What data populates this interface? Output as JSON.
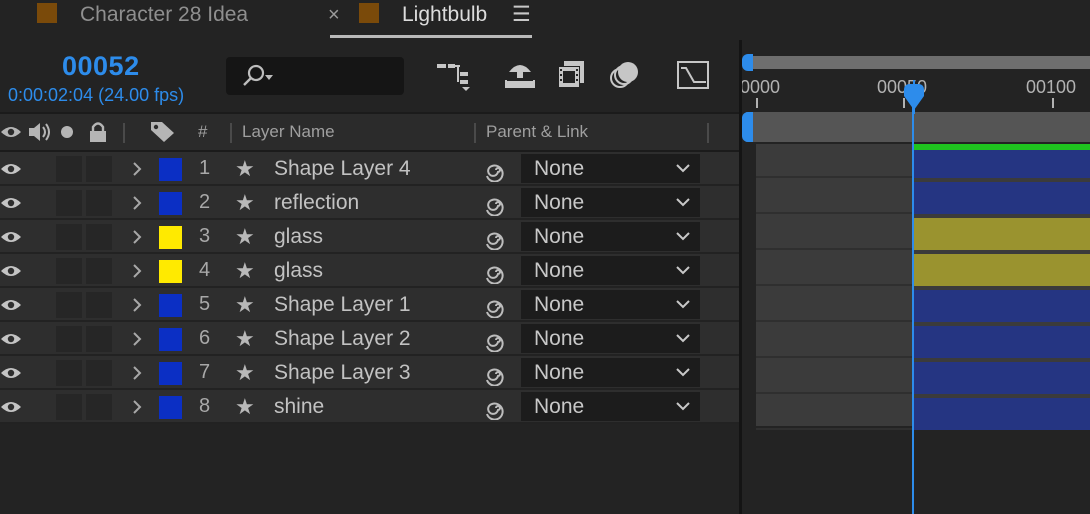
{
  "tabs": [
    {
      "label": "Character 28 Idea",
      "close_glyph": "×",
      "active": false,
      "swatch_color": "#7a4a0a"
    },
    {
      "label": "Lightbulb",
      "menu_glyph": "☰",
      "active": true,
      "swatch_color": "#7a4a0a"
    }
  ],
  "header": {
    "timecode": "00052",
    "timecode_sub": "0:00:02:04 (24.00 fps)",
    "search": {
      "value": "",
      "icon": "search-icon"
    },
    "tools": [
      "composition-mini-flowchart-icon",
      "draft-3d-icon",
      "frame-blending-icon",
      "motion-blur-icon",
      "graph-editor-icon"
    ]
  },
  "columns": {
    "av_icons": [
      "eye-icon",
      "speaker-icon",
      "solo-icon",
      "lock-icon"
    ],
    "label_icon": "label-tag-icon",
    "number": "#",
    "layer_name": "Layer Name",
    "parent_link": "Parent & Link"
  },
  "layers": [
    {
      "num": "1",
      "name": "Shape Layer 4",
      "color": "#0b2fc4",
      "parent": "None",
      "bar_color": "#253582"
    },
    {
      "num": "2",
      "name": "reflection",
      "color": "#0b2fc4",
      "parent": "None",
      "bar_color": "#253582"
    },
    {
      "num": "3",
      "name": "glass",
      "color": "#ffea00",
      "parent": "None",
      "bar_color": "#9a932f"
    },
    {
      "num": "4",
      "name": "glass",
      "color": "#ffea00",
      "parent": "None",
      "bar_color": "#9a932f"
    },
    {
      "num": "5",
      "name": "Shape Layer 1",
      "color": "#0b2fc4",
      "parent": "None",
      "bar_color": "#253582"
    },
    {
      "num": "6",
      "name": "Shape Layer 2",
      "color": "#0b2fc4",
      "parent": "None",
      "bar_color": "#253582"
    },
    {
      "num": "7",
      "name": "Shape Layer 3",
      "color": "#0b2fc4",
      "parent": "None",
      "bar_color": "#253582"
    },
    {
      "num": "8",
      "name": "shine",
      "color": "#0b2fc4",
      "parent": "None",
      "bar_color": "#253582"
    }
  ],
  "timeline": {
    "ruler_labels": [
      "0000",
      "00050",
      "00100"
    ],
    "current_frame": 52,
    "accent_color": "#2d8ceb",
    "work_area_color": "#1fc41f"
  }
}
